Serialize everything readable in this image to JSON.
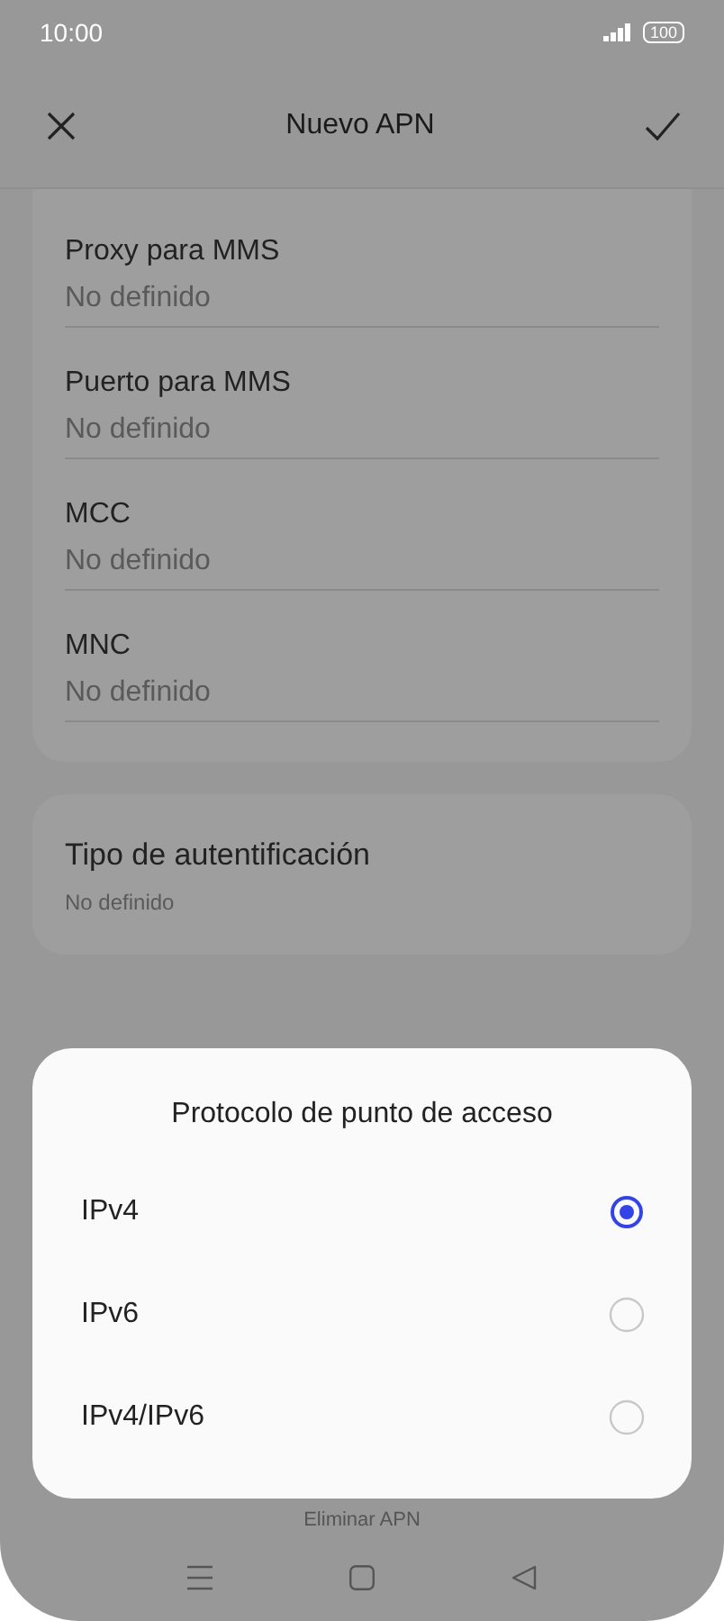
{
  "status_bar": {
    "time": "10:00",
    "battery": "100"
  },
  "header": {
    "title": "Nuevo APN"
  },
  "fields": [
    {
      "label": "Proxy para MMS",
      "value": "No definido"
    },
    {
      "label": "Puerto para MMS",
      "value": "No definido"
    },
    {
      "label": "MCC",
      "value": "No definido"
    },
    {
      "label": "MNC",
      "value": "No definido"
    }
  ],
  "auth": {
    "label": "Tipo de autentificación",
    "value": "No definido"
  },
  "delete_button": "Eliminar APN",
  "dialog": {
    "title": "Protocolo de punto de acceso",
    "options": [
      {
        "label": "IPv4",
        "selected": true
      },
      {
        "label": "IPv6",
        "selected": false
      },
      {
        "label": "IPv4/IPv6",
        "selected": false
      }
    ]
  }
}
